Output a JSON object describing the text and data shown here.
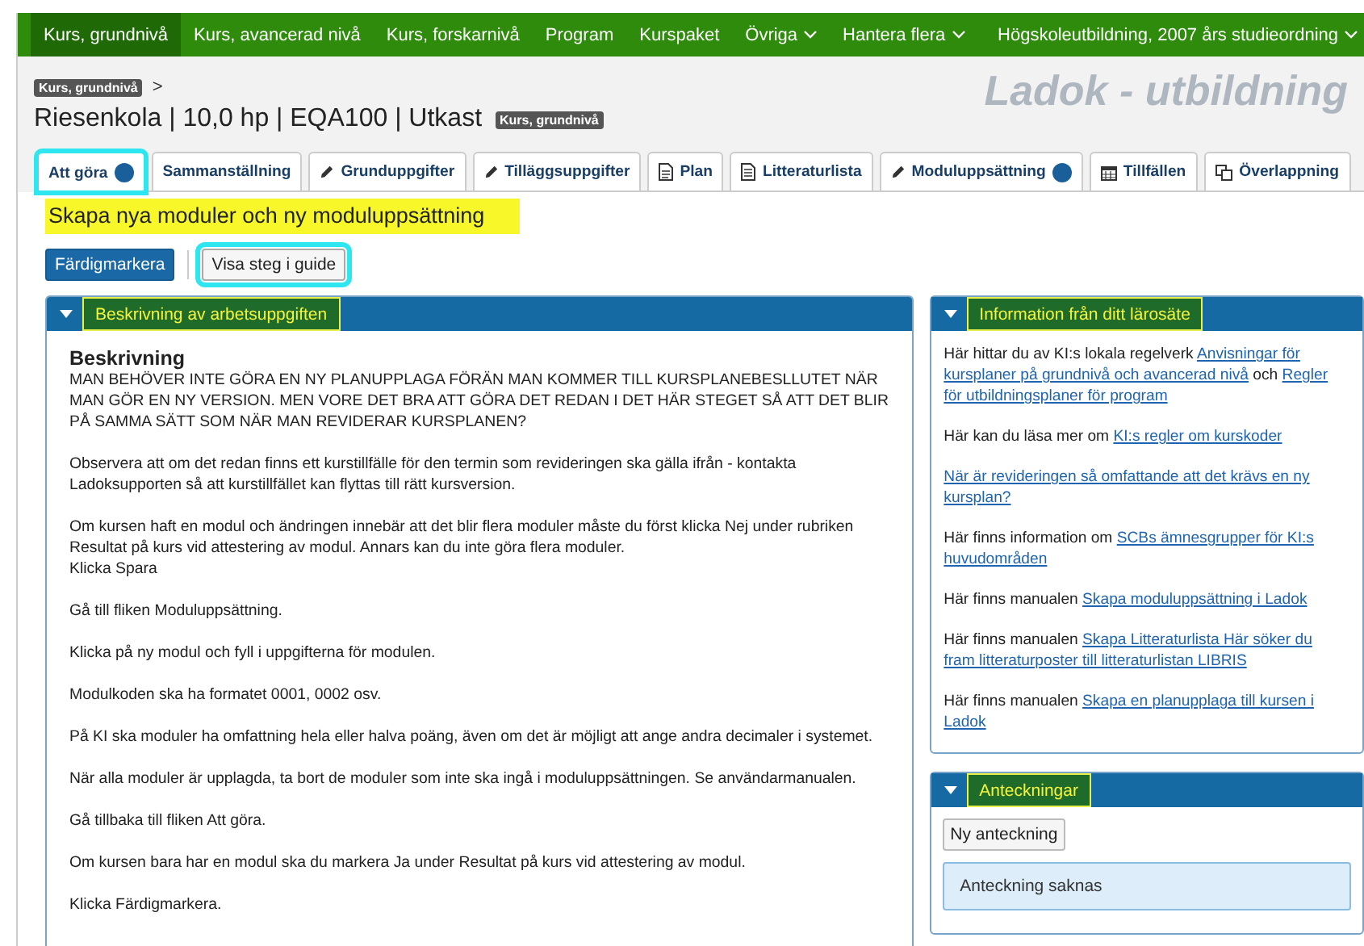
{
  "top_nav": {
    "items": [
      {
        "label": "Kurs, grundnivå",
        "selected": true,
        "kind": "link"
      },
      {
        "label": "Kurs, avancerad nivå",
        "selected": false,
        "kind": "link"
      },
      {
        "label": "Kurs, forskarnivå",
        "selected": false,
        "kind": "link"
      },
      {
        "label": "Program",
        "selected": false,
        "kind": "link"
      },
      {
        "label": "Kurspaket",
        "selected": false,
        "kind": "link"
      },
      {
        "label": "Övriga",
        "selected": false,
        "kind": "dropdown"
      },
      {
        "label": "Hantera flera",
        "selected": false,
        "kind": "dropdown"
      },
      {
        "label": "Högskoleutbildning, 2007 års studieordning",
        "selected": false,
        "kind": "dropdown"
      }
    ]
  },
  "header": {
    "breadcrumb": {
      "badge": "Kurs, grundnivå",
      "separator": ">"
    },
    "title": "Riesenkola | 10,0 hp | EQA100 | Utkast",
    "title_badge": "Kurs, grundnivå",
    "app_name": "Ladok - utbildning"
  },
  "tabs": [
    {
      "label": "Att göra",
      "selected": true,
      "dot": true,
      "highlighted": true
    },
    {
      "label": "Sammanställning",
      "selected": false,
      "dot": false,
      "highlighted": false
    },
    {
      "label": "Grunduppgifter",
      "kind": "pencil",
      "selected": false,
      "dot": false,
      "highlighted": false
    },
    {
      "label": "Tilläggsuppgifter",
      "kind": "pencil",
      "selected": false,
      "dot": false,
      "highlighted": false
    },
    {
      "label": "Plan",
      "kind": "document",
      "selected": false,
      "dot": false,
      "highlighted": false
    },
    {
      "label": "Litteraturlista",
      "kind": "list",
      "selected": false,
      "dot": false,
      "highlighted": false
    },
    {
      "label": "Moduluppsättning",
      "kind": "pencil",
      "selected": false,
      "dot": true,
      "highlighted": false
    },
    {
      "label": "Tillfällen",
      "kind": "calendar",
      "selected": false,
      "dot": false,
      "highlighted": false
    },
    {
      "label": "Överlappning",
      "kind": "overlap",
      "selected": false,
      "dot": false,
      "highlighted": false
    }
  ],
  "page_heading": {
    "text": "Skapa nya moduler och ny moduluppsättning",
    "highlighted": true
  },
  "actions": [
    {
      "label": "Färdigmarkera",
      "kind": "primary",
      "highlighted": false
    },
    {
      "label": "Visa steg i guide",
      "kind": "default",
      "highlighted": true
    }
  ],
  "description_panel": {
    "title": "Beskrivning av arbetsuppgiften",
    "expanded": true,
    "highlighted": true,
    "heading": "Beskrivning",
    "paragraphs": [
      "MAN BEHÖVER INTE GÖRA EN NY PLANUPPLAGA FÖRÄN MAN KOMMER TILL KURSPLANEBESLLUTET NÄR MAN GÖR EN NY VERSION. MEN VORE DET BRA ATT GÖRA DET REDAN I DET HÄR STEGET SÅ ATT DET BLIR PÅ SAMMA SÄTT SOM NÄR MAN REVIDERAR KURSPLANEN?",
      "Observera att om det redan finns ett kurstillfälle för den termin som revideringen ska gälla ifrån - kontakta Ladoksupporten så att kurstillfället kan flyttas till rätt kursversion.",
      "Om kursen haft en modul och ändringen innebär att det blir flera moduler måste du först klicka Nej under rubriken Resultat på kurs vid attestering av modul. Annars kan du inte göra flera moduler.\nKlicka Spara",
      "Gå till fliken Moduluppsättning.",
      "Klicka på ny modul och fyll i uppgifterna för modulen.",
      "Modulkoden ska ha formatet 0001, 0002 osv.",
      "På KI ska moduler ha omfattning hela eller halva poäng, även om det är möjligt att ange andra decimaler i systemet.",
      "När alla moduler är upplagda, ta bort de moduler som inte ska ingå i moduluppsättningen. Se användarmanualen.",
      "Gå tillbaka till fliken Att göra.",
      "Om kursen bara har en modul ska du markera Ja under Resultat på kurs vid attestering av modul.",
      "Klicka Färdigmarkera."
    ]
  },
  "info_panel": {
    "title": "Information från ditt lärosäte",
    "expanded": true,
    "highlighted": true,
    "paragraphs": [
      [
        {
          "text": "Här hittar du av KI:s lokala regelverk ",
          "kind": "text"
        },
        {
          "text": "Anvisningar för kursplaner på grundnivå och avancerad nivå",
          "kind": "link"
        },
        {
          "text": " och ",
          "kind": "text"
        },
        {
          "text": "Regler för utbildningsplaner för program",
          "kind": "link"
        }
      ],
      [
        {
          "text": "Här kan du läsa mer om ",
          "kind": "text"
        },
        {
          "text": "KI:s regler om kurskoder",
          "kind": "link"
        }
      ],
      [
        {
          "text": "När är revideringen så omfattande att det krävs en ny kursplan?",
          "kind": "link"
        }
      ],
      [
        {
          "text": "Här finns information om ",
          "kind": "text"
        },
        {
          "text": "SCBs ämnesgrupper för KI:s huvudområden",
          "kind": "link"
        }
      ],
      [
        {
          "text": "Här finns manualen ",
          "kind": "text"
        },
        {
          "text": "Skapa moduluppsättning i Ladok",
          "kind": "link"
        }
      ],
      [
        {
          "text": "Här finns manualen ",
          "kind": "text"
        },
        {
          "text": "Skapa Litteraturlista Här söker du fram litteraturposter till litteraturlistan LIBRIS",
          "kind": "link"
        }
      ],
      [
        {
          "text": "Här finns manualen ",
          "kind": "text"
        },
        {
          "text": "Skapa en planupplaga till kursen i Ladok",
          "kind": "link"
        }
      ]
    ]
  },
  "notes_panel": {
    "title": "Anteckningar",
    "expanded": true,
    "highlighted": true,
    "button": "Ny anteckning",
    "message": "Anteckning saknas"
  }
}
